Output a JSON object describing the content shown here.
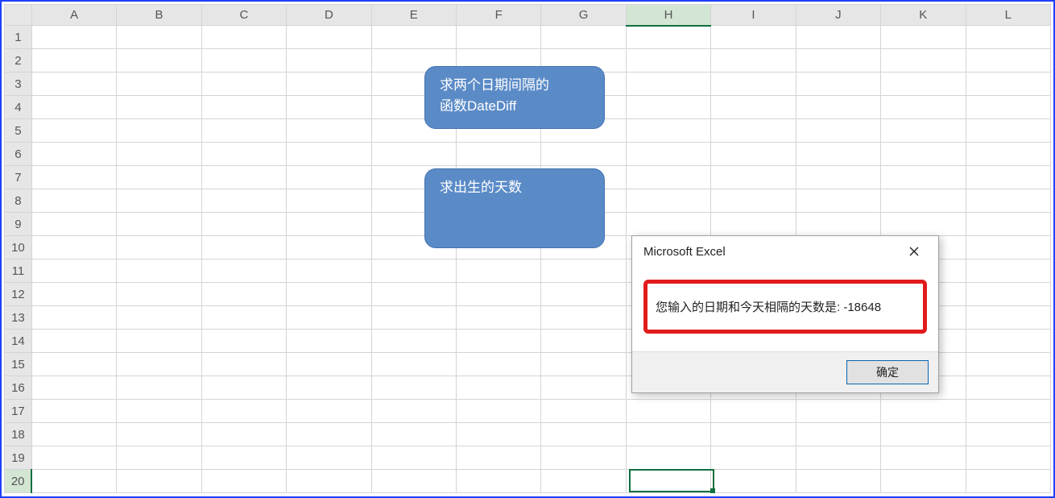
{
  "columns": [
    "A",
    "B",
    "C",
    "D",
    "E",
    "F",
    "G",
    "H",
    "I",
    "J",
    "K",
    "L"
  ],
  "row_count": 20,
  "active_col": "H",
  "active_row": 20,
  "callout1": {
    "line1": "求两个日期间隔的",
    "line2": "函数DateDiff"
  },
  "callout2": {
    "line1": "求出生的天数"
  },
  "dialog": {
    "title": "Microsoft Excel",
    "message": "您输入的日期和今天相隔的天数是: -18648",
    "ok_label": "确定",
    "close_icon": "close-icon"
  }
}
